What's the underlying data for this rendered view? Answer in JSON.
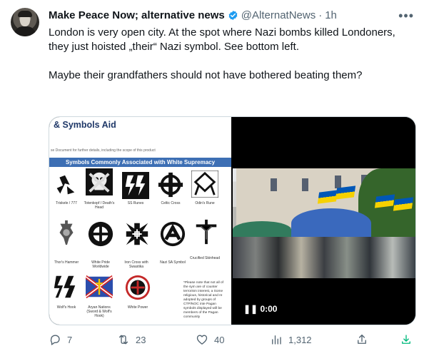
{
  "tweet": {
    "author_name": "Make Peace Now; alternative news",
    "author_handle": "@AlternatNews",
    "time": "1h",
    "text_paragraphs": [
      "London is very open city. At the spot where Nazi bombs killed Londoners, they just hoisted „their“ Nazi symbol. See bottom left.",
      "Maybe their grandfathers should not have bothered beating them?"
    ],
    "icons": {
      "more": "more-icon",
      "verified": "verified-badge-icon",
      "reply": "reply-icon",
      "retweet": "retweet-icon",
      "like": "like-icon",
      "views": "views-icon",
      "share": "share-icon",
      "download": "download-icon"
    },
    "colors": {
      "text": "#0f1419",
      "secondary": "#536471",
      "verified": "#1d9bf0",
      "download": "#00ba7c",
      "border": "#cfd9de"
    }
  },
  "media": {
    "document": {
      "title": "& Symbols Aid",
      "subtitle": "se Document for further details, including the scope of this product",
      "band": "Symbols Commonly Associated with White Supremacy",
      "symbols": [
        "Triskele / 777",
        "Totenkopf / Death's Head",
        "SS Runes",
        "Celtic Cross",
        "Odin's Rune",
        "Thor's Hammer",
        "White Pride Worldwide",
        "Iron Cross with Swastika",
        "Nazi SA Symbol",
        "Crucified Skinhead",
        "Wolf's Hook",
        "Aryan Nations (Sword & Wolf's Hook)",
        "White Power"
      ],
      "note": "*Please note that not all of the sym are of counter terrorism interest, a Some religious, historical and re adopted by groups of CTP/NOC inte Pagan symbols displayed will be members of the Pagan community"
    },
    "video": {
      "time_label": "0:00"
    }
  },
  "actions": {
    "replies": "7",
    "retweets": "23",
    "likes": "40",
    "views": "1,312"
  }
}
